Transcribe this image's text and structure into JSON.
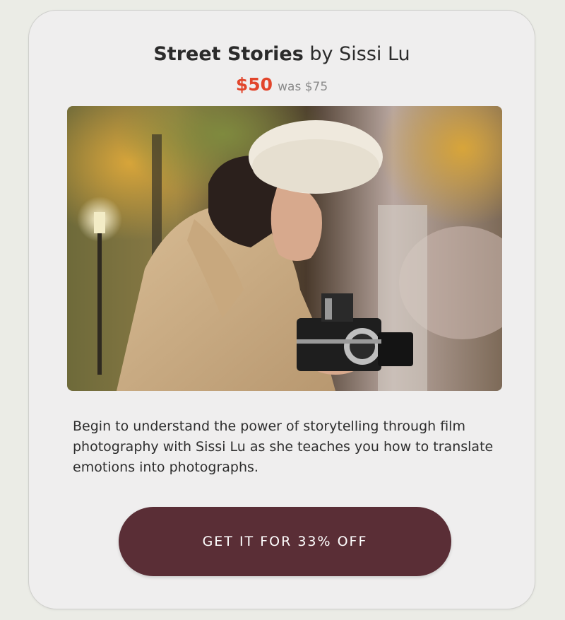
{
  "product": {
    "title": "Street Stories",
    "byline": "by Sissi Lu",
    "price_current": "$50",
    "price_was": "was $75",
    "image_description": "photo-woman-with-film-camera",
    "description": "Begin to understand the power of storytelling through film photography with Sissi Lu as she teaches you how to translate emotions into photographs.",
    "cta_label": "GET IT FOR 33% OFF"
  },
  "colors": {
    "page_background": "#ebece6",
    "card_background": "#efeeee",
    "sale_price": "#e2452b",
    "button_background": "#5a2e36",
    "button_text": "#ffffff"
  }
}
